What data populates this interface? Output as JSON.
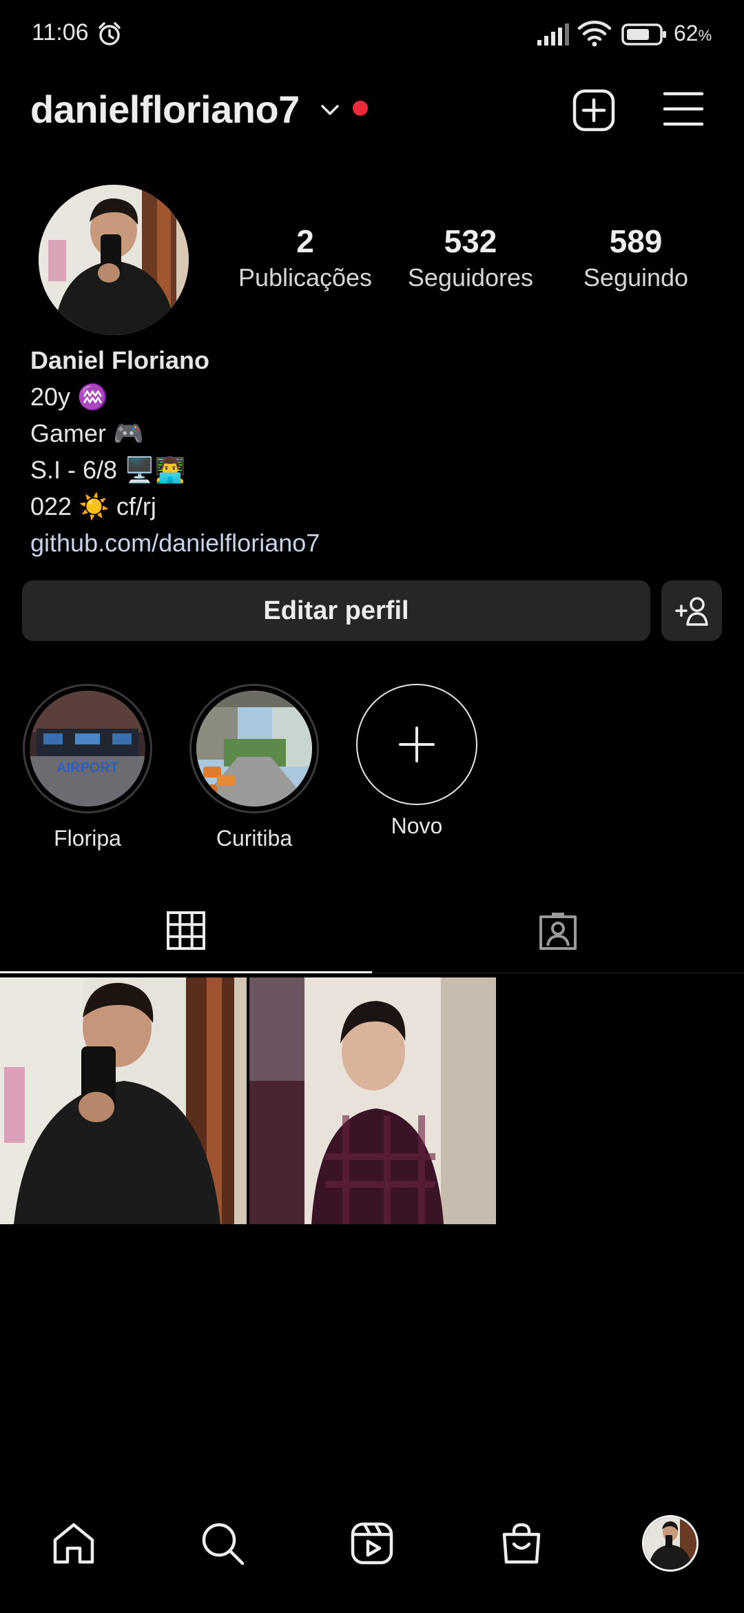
{
  "status_bar": {
    "time": "11:06",
    "battery_percent": "62",
    "battery_unit": "%",
    "icons": [
      "alarm-icon",
      "signal-icon",
      "wifi-icon",
      "battery-icon"
    ]
  },
  "header": {
    "username": "danielfloriano7",
    "icons": [
      "chevron-down-icon",
      "notification-dot",
      "add-post-icon",
      "menu-icon"
    ],
    "notification_color": "#ed2a3c"
  },
  "profile": {
    "stats": [
      {
        "value": "2",
        "label": "Publicações"
      },
      {
        "value": "532",
        "label": "Seguidores"
      },
      {
        "value": "589",
        "label": "Seguindo"
      }
    ],
    "name": "Daniel Floriano",
    "bio_lines": [
      "20y ♒",
      "Gamer 🎮",
      "S.I - 6/8 🖥️👨‍💻",
      "022 ☀️ cf/rj"
    ],
    "link": "github.com/danielfloriano7"
  },
  "actions": {
    "edit_profile": "Editar perfil",
    "add_friend_icon": "add-person-icon"
  },
  "highlights": [
    {
      "label": "Floripa",
      "image_text": "AIRPORT"
    },
    {
      "label": "Curitiba"
    },
    {
      "label": "Novo",
      "icon": "plus-icon"
    }
  ],
  "tabs": [
    {
      "icon": "grid-icon",
      "active": true
    },
    {
      "icon": "tagged-icon",
      "active": false
    }
  ],
  "nav": [
    "home-icon",
    "search-icon",
    "reels-icon",
    "shop-icon",
    "profile-avatar"
  ],
  "colors": {
    "background": "#000000",
    "surface": "#262626",
    "text": "#f5f5f5",
    "link": "#c7d3ea"
  }
}
